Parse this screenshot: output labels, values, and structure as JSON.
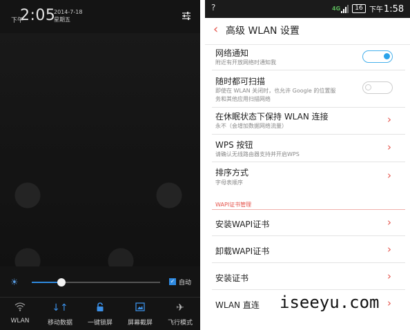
{
  "notification_shade": {
    "ampm": "下午",
    "time": "2:05",
    "date": "2014-7-18",
    "weekday": "星期五",
    "brightness": {
      "level": 0.23,
      "auto_label": "自动",
      "auto_checked": true,
      "accent": "#2f8ae0"
    },
    "toggles": [
      {
        "label": "WLAN",
        "icon": "wifi-icon"
      },
      {
        "label": "移动数据",
        "icon": "data-arrows-icon"
      },
      {
        "label": "一键锁屏",
        "icon": "lock-icon"
      },
      {
        "label": "屏幕截屏",
        "icon": "screenshot-icon"
      },
      {
        "label": "飞行模式",
        "icon": "airplane-icon"
      }
    ]
  },
  "statusbar": {
    "network": "4G",
    "battery": "16",
    "ampm": "下午",
    "time": "1:58"
  },
  "settings": {
    "title": "高级 WLAN 设置",
    "accent": "#e5534b",
    "rows": [
      {
        "title": "网络通知",
        "subtitle": "附近有开放网络时通知我",
        "control": "switch-on"
      },
      {
        "title": "随时都可扫描",
        "subtitle": "即使在 WLAN 关闭时，也允许 Google 的位置服",
        "subtitle2": "务和其他应用扫描网络",
        "control": "switch-off"
      },
      {
        "title": "在休眠状态下保持 WLAN 连接",
        "subtitle": "永不（会增加数据网络流量）",
        "control": "chevron"
      },
      {
        "title": "WPS 按钮",
        "subtitle": "请确认无线路由器支持并开启WPS",
        "control": "chevron"
      },
      {
        "title": "排序方式",
        "subtitle": "字母表顺序",
        "control": "chevron"
      }
    ],
    "section_header": "WAPI证书管理",
    "cert_rows": [
      {
        "title": "安装WAPI证书"
      },
      {
        "title": "卸载WAPI证书"
      },
      {
        "title": "安装证书"
      },
      {
        "title": "WLAN 直连"
      }
    ]
  },
  "watermark": "iseeyu.com"
}
